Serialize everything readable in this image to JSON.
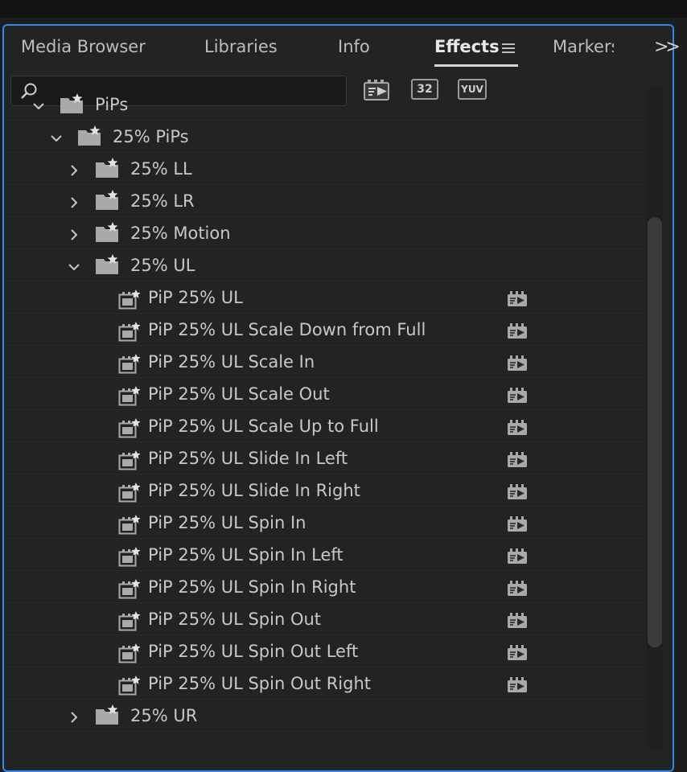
{
  "tabs": {
    "media_browser": "Media Browser",
    "libraries": "Libraries",
    "info": "Info",
    "effects": "Effects",
    "markers": "Markers"
  },
  "search": {
    "value": "",
    "placeholder": ""
  },
  "toolbar": {
    "accelerated_icon": "accelerated-effects-icon",
    "bit32_label": "32",
    "yuv_label": "YUV"
  },
  "tree": [
    {
      "label": "PiPs",
      "kind": "folder",
      "level": 0,
      "expanded": true
    },
    {
      "label": "25% PiPs",
      "kind": "folder",
      "level": 1,
      "expanded": true
    },
    {
      "label": "25% LL",
      "kind": "folder",
      "level": 2,
      "expanded": false
    },
    {
      "label": "25% LR",
      "kind": "folder",
      "level": 2,
      "expanded": false
    },
    {
      "label": "25% Motion",
      "kind": "folder",
      "level": 2,
      "expanded": false
    },
    {
      "label": "25% UL",
      "kind": "folder",
      "level": 2,
      "expanded": true
    },
    {
      "label": "PiP 25% UL",
      "kind": "preset",
      "level": 3
    },
    {
      "label": "PiP 25% UL Scale Down from Full",
      "kind": "preset",
      "level": 3
    },
    {
      "label": "PiP 25% UL Scale In",
      "kind": "preset",
      "level": 3
    },
    {
      "label": "PiP 25% UL Scale Out",
      "kind": "preset",
      "level": 3
    },
    {
      "label": "PiP 25% UL Scale Up to Full",
      "kind": "preset",
      "level": 3
    },
    {
      "label": "PiP 25% UL Slide In Left",
      "kind": "preset",
      "level": 3
    },
    {
      "label": "PiP 25% UL Slide In Right",
      "kind": "preset",
      "level": 3
    },
    {
      "label": "PiP 25% UL Spin In",
      "kind": "preset",
      "level": 3
    },
    {
      "label": "PiP 25% UL Spin In Left",
      "kind": "preset",
      "level": 3
    },
    {
      "label": "PiP 25% UL Spin In Right",
      "kind": "preset",
      "level": 3
    },
    {
      "label": "PiP 25% UL Spin Out",
      "kind": "preset",
      "level": 3
    },
    {
      "label": "PiP 25% UL Spin Out Left",
      "kind": "preset",
      "level": 3
    },
    {
      "label": "PiP 25% UL Spin Out Right",
      "kind": "preset",
      "level": 3
    },
    {
      "label": "25% UR",
      "kind": "folder",
      "level": 2,
      "expanded": false
    }
  ],
  "colors": {
    "accent": "#2d8ceb",
    "panel_bg": "#232323",
    "text": "#c8c8c8"
  }
}
